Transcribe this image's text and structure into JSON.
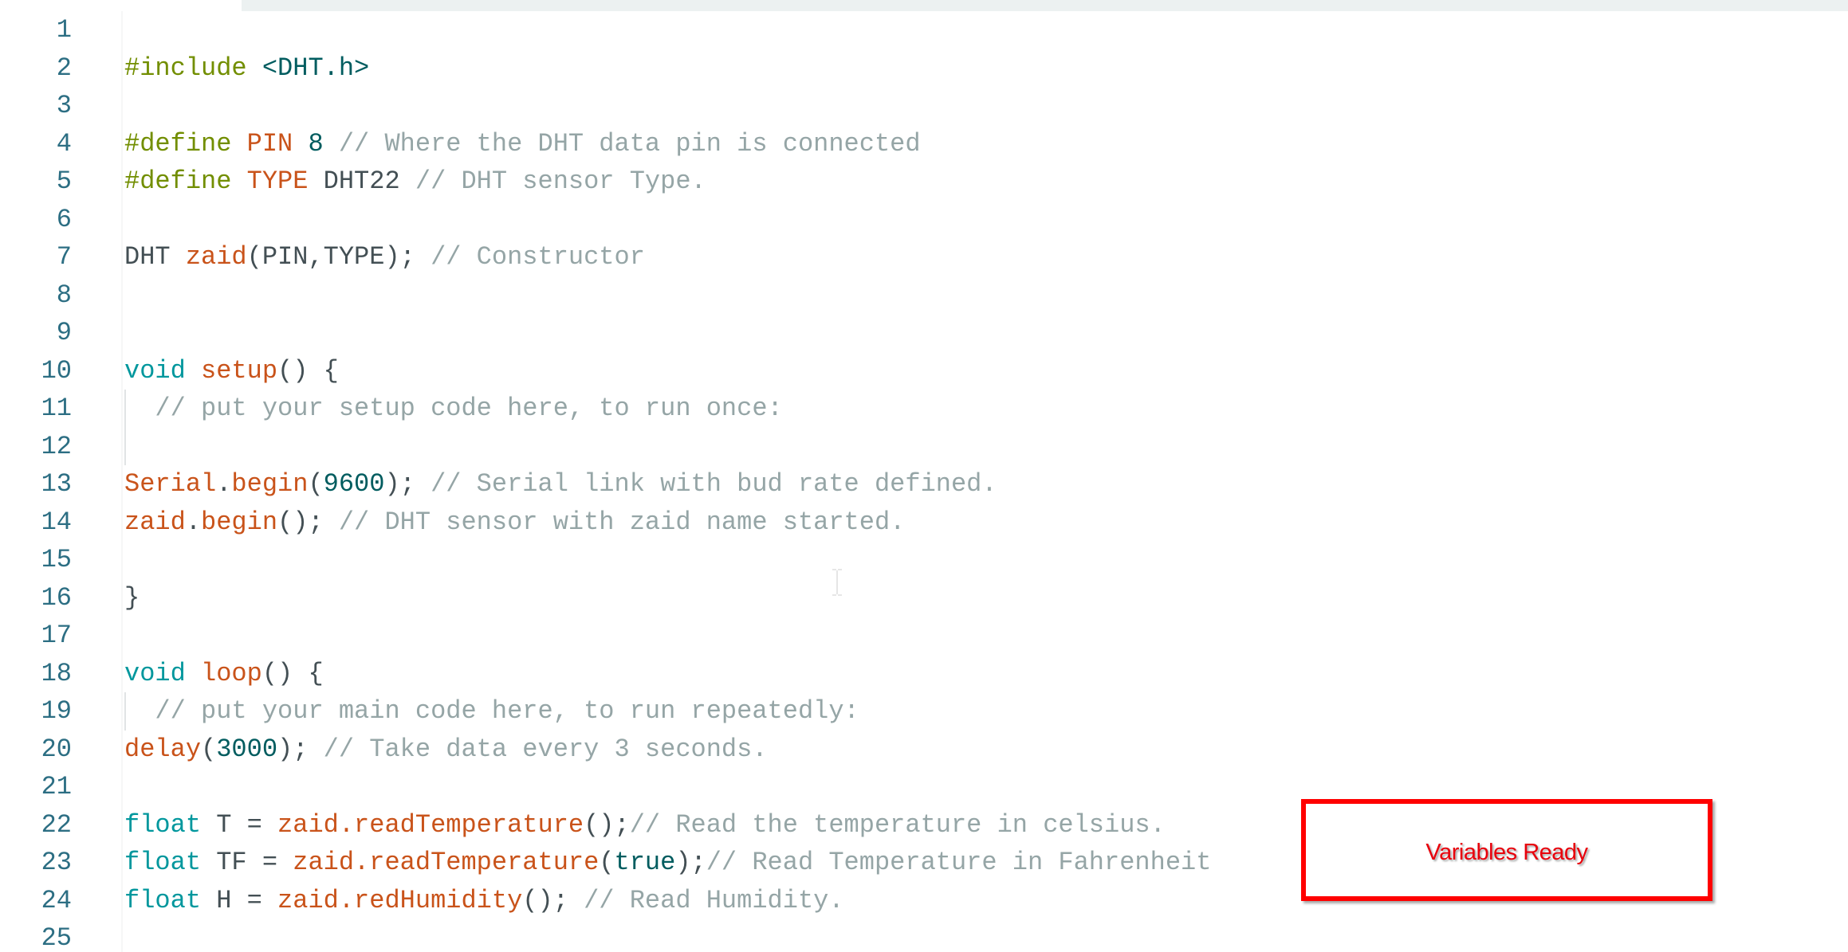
{
  "editor": {
    "lines": [
      {
        "n": "1",
        "tokens": []
      },
      {
        "n": "2",
        "tokens": [
          {
            "t": "pp",
            "v": "#include "
          },
          {
            "t": "num",
            "v": "<DHT.h>"
          }
        ]
      },
      {
        "n": "3",
        "tokens": []
      },
      {
        "n": "4",
        "tokens": [
          {
            "t": "pp",
            "v": "#define "
          },
          {
            "t": "fn",
            "v": "PIN"
          },
          {
            "t": "tx",
            "v": " "
          },
          {
            "t": "num",
            "v": "8"
          },
          {
            "t": "cm",
            "v": " // Where the DHT data pin is connected"
          }
        ]
      },
      {
        "n": "5",
        "tokens": [
          {
            "t": "pp",
            "v": "#define "
          },
          {
            "t": "fn",
            "v": "TYPE"
          },
          {
            "t": "tx",
            "v": " DHT22"
          },
          {
            "t": "cm",
            "v": " // DHT sensor Type."
          }
        ]
      },
      {
        "n": "6",
        "tokens": []
      },
      {
        "n": "7",
        "tokens": [
          {
            "t": "tx",
            "v": "DHT "
          },
          {
            "t": "fn",
            "v": "zaid"
          },
          {
            "t": "tx",
            "v": "(PIN,TYPE); "
          },
          {
            "t": "cm",
            "v": "// Constructor"
          }
        ]
      },
      {
        "n": "8",
        "tokens": []
      },
      {
        "n": "9",
        "tokens": []
      },
      {
        "n": "10",
        "tokens": [
          {
            "t": "kw",
            "v": "void"
          },
          {
            "t": "tx",
            "v": " "
          },
          {
            "t": "fn",
            "v": "setup"
          },
          {
            "t": "tx",
            "v": "() {"
          }
        ]
      },
      {
        "n": "11",
        "guide": true,
        "tokens": [
          {
            "t": "tx",
            "v": "  "
          },
          {
            "t": "cm",
            "v": "// put your setup code here, to run once:"
          }
        ]
      },
      {
        "n": "12",
        "guide": true,
        "tokens": []
      },
      {
        "n": "13",
        "tokens": [
          {
            "t": "fn",
            "v": "Serial"
          },
          {
            "t": "tx",
            "v": "."
          },
          {
            "t": "fn",
            "v": "begin"
          },
          {
            "t": "tx",
            "v": "("
          },
          {
            "t": "num",
            "v": "9600"
          },
          {
            "t": "tx",
            "v": "); "
          },
          {
            "t": "cm",
            "v": "// Serial link with bud rate defined."
          }
        ]
      },
      {
        "n": "14",
        "tokens": [
          {
            "t": "fn",
            "v": "zaid"
          },
          {
            "t": "tx",
            "v": "."
          },
          {
            "t": "fn",
            "v": "begin"
          },
          {
            "t": "tx",
            "v": "(); "
          },
          {
            "t": "cm",
            "v": "// DHT sensor with zaid name started."
          }
        ]
      },
      {
        "n": "15",
        "tokens": []
      },
      {
        "n": "16",
        "tokens": [
          {
            "t": "tx",
            "v": "}"
          }
        ]
      },
      {
        "n": "17",
        "tokens": []
      },
      {
        "n": "18",
        "tokens": [
          {
            "t": "kw",
            "v": "void"
          },
          {
            "t": "tx",
            "v": " "
          },
          {
            "t": "fn",
            "v": "loop"
          },
          {
            "t": "tx",
            "v": "() {"
          }
        ]
      },
      {
        "n": "19",
        "guide": true,
        "tokens": [
          {
            "t": "tx",
            "v": "  "
          },
          {
            "t": "cm",
            "v": "// put your main code here, to run repeatedly:"
          }
        ]
      },
      {
        "n": "20",
        "tokens": [
          {
            "t": "fn",
            "v": "delay"
          },
          {
            "t": "tx",
            "v": "("
          },
          {
            "t": "num",
            "v": "3000"
          },
          {
            "t": "tx",
            "v": "); "
          },
          {
            "t": "cm",
            "v": "// Take data every 3 seconds."
          }
        ]
      },
      {
        "n": "21",
        "tokens": []
      },
      {
        "n": "22",
        "tokens": [
          {
            "t": "kw",
            "v": "float"
          },
          {
            "t": "tx",
            "v": " T = "
          },
          {
            "t": "fn",
            "v": "zaid"
          },
          {
            "t": "fn",
            "v": "."
          },
          {
            "t": "fn",
            "v": "readTemperature"
          },
          {
            "t": "tx",
            "v": "();"
          },
          {
            "t": "cm",
            "v": "// Read the temperature in celsius."
          }
        ]
      },
      {
        "n": "23",
        "tokens": [
          {
            "t": "kw",
            "v": "float"
          },
          {
            "t": "tx",
            "v": " TF = "
          },
          {
            "t": "fn",
            "v": "zaid"
          },
          {
            "t": "fn",
            "v": "."
          },
          {
            "t": "fn",
            "v": "readTemperature"
          },
          {
            "t": "tx",
            "v": "("
          },
          {
            "t": "lit",
            "v": "true"
          },
          {
            "t": "tx",
            "v": ");"
          },
          {
            "t": "cm",
            "v": "// Read Temperature in Fahrenheit"
          }
        ]
      },
      {
        "n": "24",
        "tokens": [
          {
            "t": "kw",
            "v": "float"
          },
          {
            "t": "tx",
            "v": " H = "
          },
          {
            "t": "fn",
            "v": "zaid"
          },
          {
            "t": "fn",
            "v": "."
          },
          {
            "t": "fn",
            "v": "redHumidity"
          },
          {
            "t": "tx",
            "v": "(); "
          },
          {
            "t": "cm",
            "v": "// Read Humidity."
          }
        ]
      },
      {
        "n": "25",
        "tokens": []
      }
    ]
  },
  "annotation": {
    "label": "Variables Ready",
    "border_color": "#FF0000",
    "text_color": "#E8000B"
  },
  "syntax_colors": {
    "preprocessor": "#728E00",
    "function": "#C9531A",
    "keyword": "#00979D",
    "number": "#005C5F",
    "comment": "#95A5A6",
    "text": "#434F54",
    "line_number": "#2C6E83"
  },
  "cursor": {
    "icon": "i-beam-cursor-icon"
  }
}
